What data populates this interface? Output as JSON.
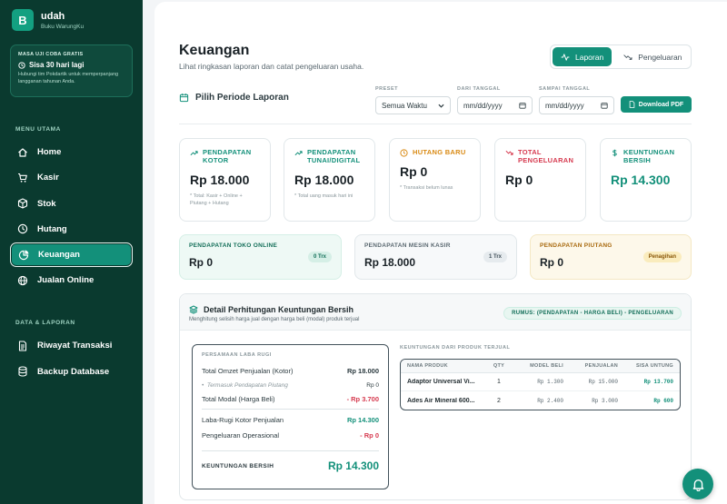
{
  "brand": {
    "logo_letter": "B",
    "name": "udah",
    "sub": "Buku WarungKu"
  },
  "trial": {
    "title": "MASA UJI COBA GRATIS",
    "days": "Sisa 30 hari lagi",
    "desc": "Hubungi tim Pokdartik untuk memperpanjang langganan tahunan Anda."
  },
  "sidebar": {
    "section_main": "MENU UTAMA",
    "main_items": [
      {
        "label": "Home",
        "icon": "home-icon"
      },
      {
        "label": "Kasir",
        "icon": "cart-icon"
      },
      {
        "label": "Stok",
        "icon": "box-icon"
      },
      {
        "label": "Hutang",
        "icon": "clock-icon"
      },
      {
        "label": "Keuangan",
        "icon": "pie-chart-icon",
        "active": true
      },
      {
        "label": "Jualan Online",
        "icon": "globe-icon"
      }
    ],
    "section_data": "DATA & LAPORAN",
    "data_items": [
      {
        "label": "Riwayat Transaksi",
        "icon": "document-icon"
      },
      {
        "label": "Backup Database",
        "icon": "database-icon"
      }
    ]
  },
  "header": {
    "title": "Keuangan",
    "subtitle": "Lihat ringkasan laporan dan catat pengeluaran usaha.",
    "tab_laporan": "Laporan",
    "tab_pengeluaran": "Pengeluaran"
  },
  "filter": {
    "periode_label": "Pilih Periode Laporan",
    "preset_label": "PRESET",
    "preset_value": "Semua Waktu",
    "from_label": "DARI TANGGAL",
    "from_value": "mm/dd/yyyy",
    "to_label": "SAMPAI TANGGAL",
    "to_value": "mm/dd/yyyy",
    "pdf_button": "Download PDF"
  },
  "cards": [
    {
      "title": "PENDAPATAN KOTOR",
      "value": "Rp 18.000",
      "note": "* Total: Kasir + Online + Piutang + Hutang",
      "color": "#13907a"
    },
    {
      "title": "PENDAPATAN TUNAI/DIGITAL",
      "value": "Rp 18.000",
      "note": "* Total uang masuk hari ini",
      "color": "#13907a"
    },
    {
      "title": "HUTANG BARU",
      "value": "Rp 0",
      "note": "* Transaksi belum lunas",
      "color": "#d98a14"
    },
    {
      "title": "TOTAL PENGELUARAN",
      "value": "Rp 0",
      "note": "",
      "color": "#d63a4f"
    },
    {
      "title": "KEUNTUNGAN BERSIH",
      "value": "Rp 14.300",
      "note": "",
      "color": "#13907a"
    }
  ],
  "strips": [
    {
      "title": "PENDAPATAN TOKO ONLINE",
      "value": "Rp 0",
      "badge": "0 Trx"
    },
    {
      "title": "PENDAPATAN MESIN KASIR",
      "value": "Rp 18.000",
      "badge": "1 Trx"
    },
    {
      "title": "PENDAPATAN PIUTANG",
      "value": "Rp 0",
      "badge": "Penagihan"
    }
  ],
  "detail": {
    "title": "Detail Perhitungan Keuntungan Bersih",
    "desc": "Menghitung selisih harga jual dengan harga beli (modal) produk terjual",
    "rumus": "RUMUS: (PENDAPATAN - HARGA BELI) - PENGELUARAN",
    "lr_title": "PERSAMAAN LABA RUGI",
    "omzet_label": "Total Omzet Penjualan (Kotor)",
    "omzet_value": "Rp 18.000",
    "piutang_label": "Termasuk Pendapatan Piutang",
    "piutang_value": "Rp 0",
    "modal_label": "Total Modal (Harga Beli)",
    "modal_value": "- Rp 3.700",
    "laba_label": "Laba-Rugi Kotor Penjualan",
    "laba_value": "Rp 14.300",
    "ops_label": "Pengeluaran Operasional",
    "ops_value": "- Rp 0",
    "net_label": "KEUNTUNGAN BERSIH",
    "net_value": "Rp 14.300",
    "table_title": "KEUNTUNGAN DARI PRODUK TERJUAL",
    "columns": [
      "NAMA PRODUK",
      "QTY",
      "MODEL BELI",
      "PENJUALAN",
      "SISA UNTUNG"
    ],
    "rows": [
      {
        "name": "Adaptor Universal Vi...",
        "qty": "1",
        "modal": "Rp 1.300",
        "jual": "Rp 15.000",
        "untung": "Rp 13.700"
      },
      {
        "name": "Ades Air Mineral 600...",
        "qty": "2",
        "modal": "Rp 2.400",
        "jual": "Rp 3.000",
        "untung": "Rp 600"
      }
    ]
  },
  "colors": {
    "sidebar": "#0a3a2f",
    "accent": "#13907a",
    "danger": "#d63a4f",
    "warning": "#d98a14"
  }
}
